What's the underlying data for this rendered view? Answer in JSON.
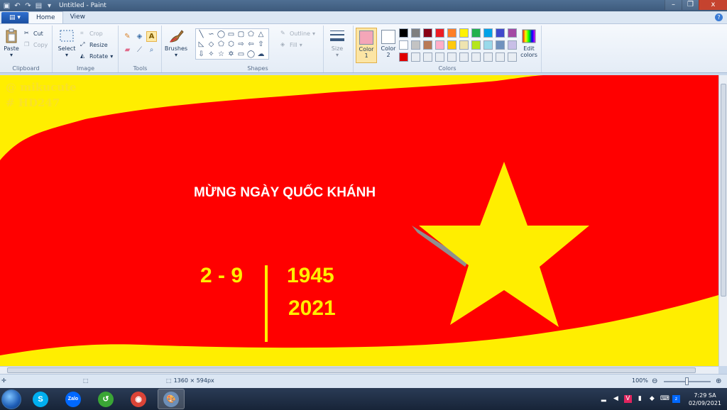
{
  "window": {
    "title": "Untitled - Paint",
    "controls": {
      "minimize": "–",
      "maximize": "❐",
      "close": "x"
    }
  },
  "tabs": [
    {
      "label": "Home",
      "active": true
    },
    {
      "label": "View",
      "active": false
    }
  ],
  "ribbon": {
    "clipboard": {
      "group_label": "Clipboard",
      "paste": "Paste",
      "cut": "Cut",
      "copy": "Copy"
    },
    "image": {
      "group_label": "Image",
      "select": "Select",
      "crop": "Crop",
      "resize": "Resize",
      "rotate": "Rotate"
    },
    "tools": {
      "group_label": "Tools",
      "brushes": "Brushes"
    },
    "shapes": {
      "group_label": "Shapes",
      "outline": "Outline",
      "fill": "Fill",
      "size": "Size"
    },
    "colors": {
      "group_label": "Colors",
      "color1_label": "Color",
      "color1_num": "1",
      "color2_label": "Color",
      "color2_num": "2",
      "color1_value": "#f4a6b8",
      "color2_value": "#ffffff",
      "edit_colors_line1": "Edit",
      "edit_colors_line2": "colors",
      "palette_row1": [
        "#000000",
        "#7f7f7f",
        "#880015",
        "#ed1c24",
        "#ff7f27",
        "#fff200",
        "#22b14c",
        "#00a2e8",
        "#3f48cc",
        "#a349a4"
      ],
      "palette_row2": [
        "#ffffff",
        "#c3c3c3",
        "#b97a57",
        "#ffaec9",
        "#ffc90e",
        "#efe4b0",
        "#b5e61d",
        "#99d9ea",
        "#7092be",
        "#c8bfe7"
      ],
      "palette_row3": [
        "#e00000",
        "#e8edf3",
        "#e8edf3",
        "#e8edf3",
        "#e8edf3",
        "#e8edf3",
        "#e8edf3",
        "#e8edf3",
        "#e8edf3",
        "#e8edf3"
      ]
    }
  },
  "canvas": {
    "watermark_line1": "@ mikucute",
    "watermark_line2": "# HD247",
    "headline": "MỪNG NGÀY QUỐC KHÁNH",
    "date": "2 - 9",
    "year1": "1945",
    "year2": "2021",
    "colors": {
      "flag_red": "#ff0000",
      "background_yellow": "#ffee00",
      "star_yellow": "#ffee00"
    }
  },
  "statusbar": {
    "dimensions": "1360 × 594px",
    "zoom": "100%"
  },
  "taskbar": {
    "apps": [
      {
        "name": "skype",
        "glyph": "S",
        "color": "#00aff0"
      },
      {
        "name": "zalo",
        "glyph": "Zalo",
        "color": "#0068ff"
      },
      {
        "name": "green-app",
        "glyph": "↺",
        "color": "#3aa635"
      },
      {
        "name": "chrome",
        "glyph": "◉",
        "color": "#db4437"
      },
      {
        "name": "paint",
        "glyph": "🎨",
        "color": "#6d8fb8"
      }
    ],
    "time": "7:29 SA",
    "date": "02/09/2021"
  }
}
